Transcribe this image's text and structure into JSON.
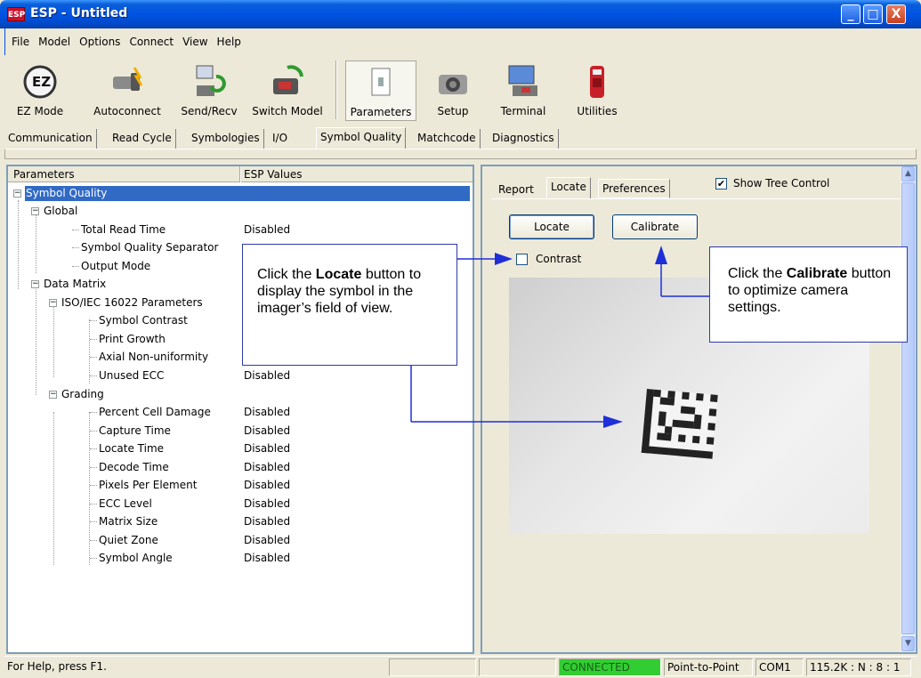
{
  "window": {
    "title": "ESP - Untitled",
    "icon_text": "ESP",
    "minimize": "_",
    "maximize": "□",
    "close": "X"
  },
  "menu": [
    "File",
    "Model",
    "Options",
    "Connect",
    "View",
    "Help"
  ],
  "toolbar": {
    "ez_mode": "EZ Mode",
    "autoconnect": "Autoconnect",
    "send_recv": "Send/Recv",
    "switch_model": "Switch Model",
    "parameters": "Parameters",
    "setup": "Setup",
    "terminal": "Terminal",
    "utilities": "Utilities"
  },
  "tabs": [
    "Communication",
    "Read Cycle",
    "Symbologies",
    "I/O",
    "Symbol Quality",
    "Matchcode",
    "Diagnostics"
  ],
  "active_tab": "Symbol Quality",
  "tree": {
    "col_parameters": "Parameters",
    "col_values": "ESP Values",
    "rows": [
      {
        "label": "Symbol Quality",
        "value": ""
      },
      {
        "label": "Global",
        "value": ""
      },
      {
        "label": "Total Read Time",
        "value": "Disabled"
      },
      {
        "label": "Symbol Quality Separator",
        "value": ""
      },
      {
        "label": "Output Mode",
        "value": ""
      },
      {
        "label": "Data Matrix",
        "value": ""
      },
      {
        "label": "ISO/IEC 16022 Parameters",
        "value": ""
      },
      {
        "label": "Symbol Contrast",
        "value": ""
      },
      {
        "label": "Print Growth",
        "value": ""
      },
      {
        "label": "Axial Non-uniformity",
        "value": ""
      },
      {
        "label": "Unused ECC",
        "value": "Disabled"
      },
      {
        "label": "Grading",
        "value": ""
      },
      {
        "label": "Percent Cell Damage",
        "value": "Disabled"
      },
      {
        "label": "Capture Time",
        "value": "Disabled"
      },
      {
        "label": "Locate Time",
        "value": "Disabled"
      },
      {
        "label": "Decode Time",
        "value": "Disabled"
      },
      {
        "label": "Pixels Per Element",
        "value": "Disabled"
      },
      {
        "label": "ECC Level",
        "value": "Disabled"
      },
      {
        "label": "Matrix Size",
        "value": "Disabled"
      },
      {
        "label": "Quiet Zone",
        "value": "Disabled"
      },
      {
        "label": "Symbol Angle",
        "value": "Disabled"
      }
    ]
  },
  "right": {
    "tabs": [
      "Report",
      "Locate",
      "Preferences"
    ],
    "active_tab": "Locate",
    "show_tree_label": "Show Tree Control",
    "show_tree_checked": "✔",
    "locate_button": "Locate",
    "calibrate_button": "Calibrate",
    "contrast_label": "Contrast"
  },
  "callouts": {
    "locate": {
      "pre": "Click the ",
      "bold": "Locate",
      "post": " button to display the symbol in the imager’s field of view."
    },
    "calibrate": {
      "pre": "Click the ",
      "bold": "Calibrate",
      "post": " button to optimize camera settings."
    }
  },
  "status": {
    "help": "For Help, press F1.",
    "connected": "CONNECTED",
    "mode": "Point-to-Point",
    "port": "COM1",
    "settings": "115.2K : N : 8 : 1"
  },
  "colors": {
    "titlebar": "#0054e3",
    "selection": "#316ac5",
    "connected": "#32cd32",
    "callout_border": "#2e3aa8",
    "arrow": "#1f2fd8"
  }
}
